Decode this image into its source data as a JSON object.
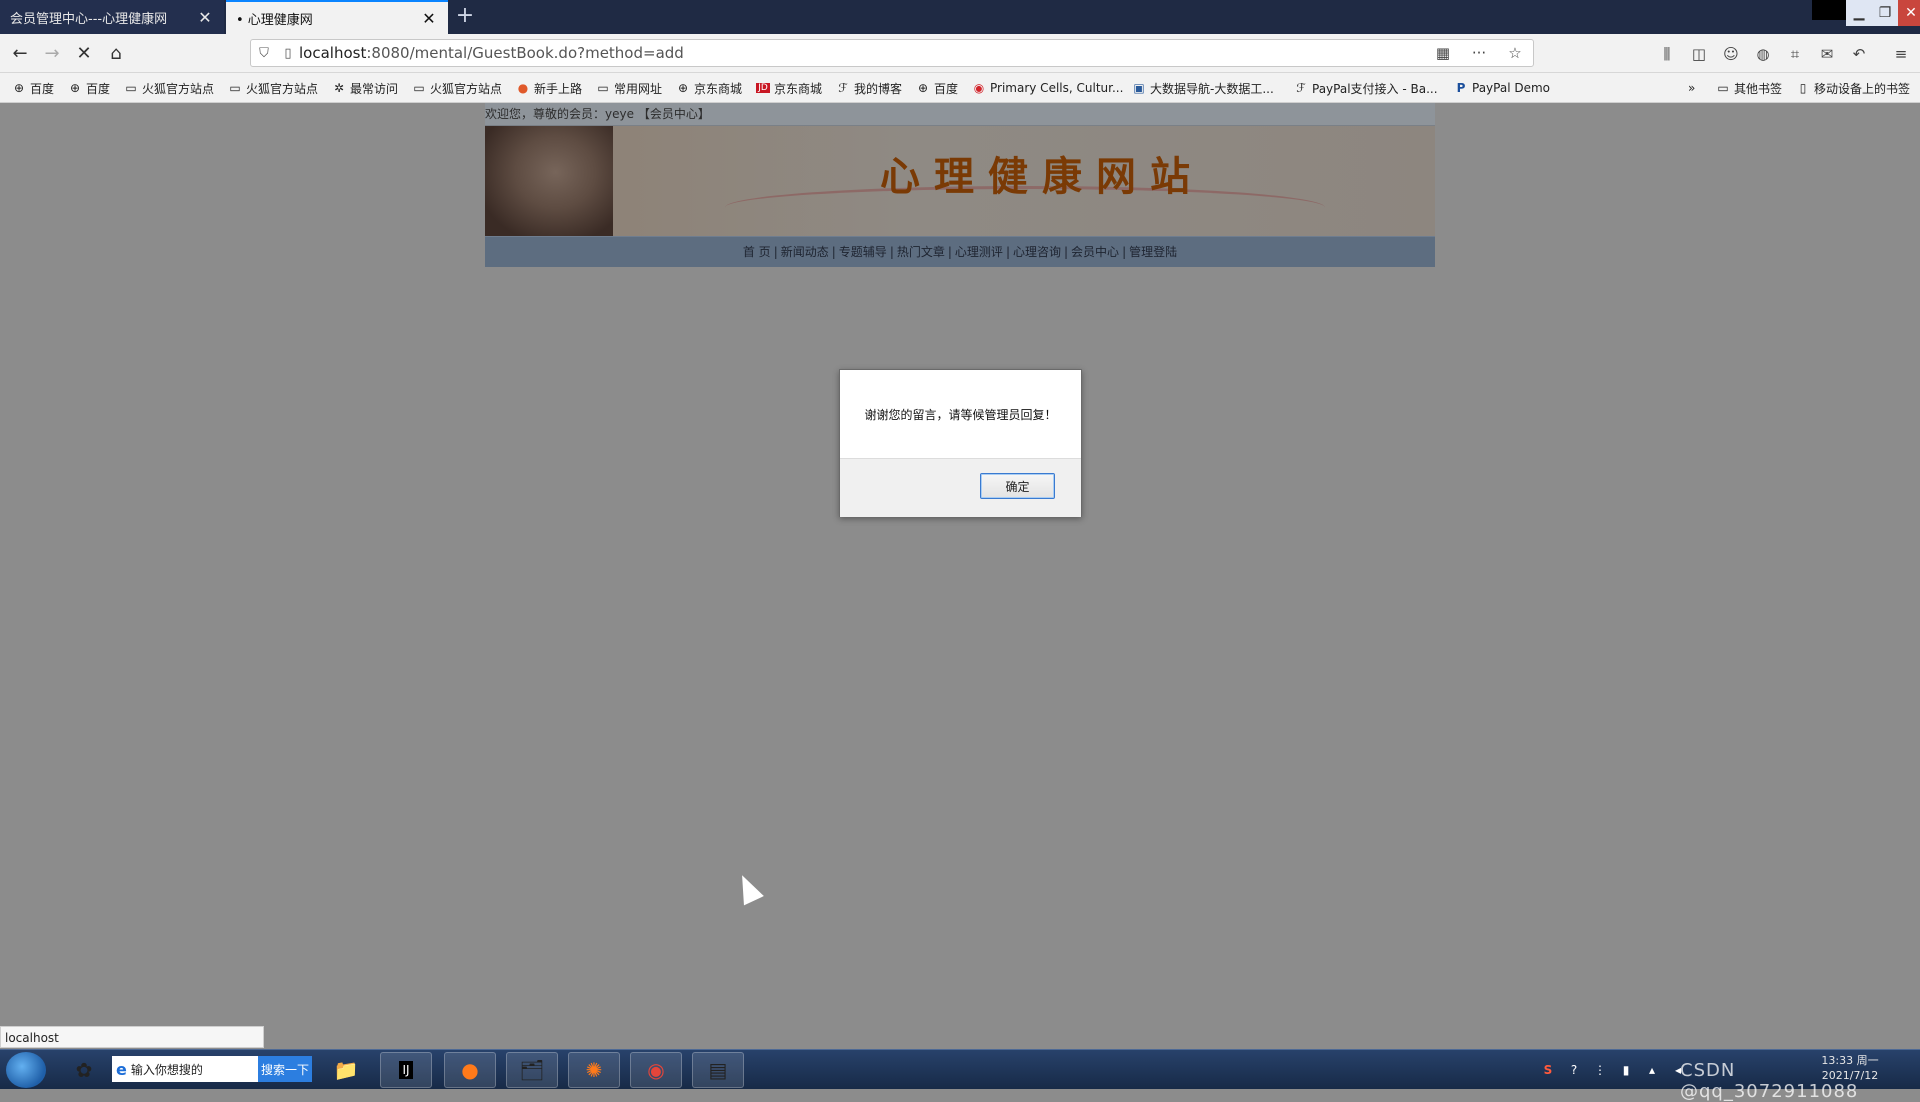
{
  "browser": {
    "tabs": [
      {
        "label": "会员管理中心---心理健康网",
        "active": false
      },
      {
        "label": "• 心理健康网",
        "active": true
      }
    ],
    "new_tab": "+",
    "url_host": "localhost",
    "url_path": ":8080/mental/GuestBook.do?method=add",
    "status_url": "localhost"
  },
  "bookmarks": [
    {
      "icon": "globe-icon",
      "label": "百度"
    },
    {
      "icon": "globe-icon",
      "label": "百度"
    },
    {
      "icon": "folder-icon",
      "label": "火狐官方站点"
    },
    {
      "icon": "folder-icon",
      "label": "火狐官方站点"
    },
    {
      "icon": "gear-icon",
      "label": "最常访问"
    },
    {
      "icon": "folder-icon",
      "label": "火狐官方站点"
    },
    {
      "icon": "firefox-icon",
      "label": "新手上路"
    },
    {
      "icon": "folder-icon",
      "label": "常用网址"
    },
    {
      "icon": "globe-icon",
      "label": "京东商城"
    },
    {
      "icon": "jd-icon",
      "label": "京东商城"
    },
    {
      "icon": "blog-icon",
      "label": "我的博客"
    },
    {
      "icon": "globe-icon",
      "label": "百度"
    },
    {
      "icon": "opera-icon",
      "label": "Primary Cells, Cultur..."
    },
    {
      "icon": "site-icon",
      "label": "大数据导航-大数据工..."
    },
    {
      "icon": "blog-icon",
      "label": "PayPal支付接入 - Ba..."
    },
    {
      "icon": "paypal-icon",
      "label": "PayPal Demo"
    }
  ],
  "bookmarks_right": [
    {
      "icon": "folder-icon",
      "label": "其他书签"
    },
    {
      "icon": "mobile-icon",
      "label": "移动设备上的书签"
    }
  ],
  "site": {
    "welcome_prefix": "欢迎您，尊敬的会员：yeye",
    "welcome_link": "【会员中心】",
    "banner_title": "心理健康网站",
    "nav": [
      "首 页",
      "新闻动态",
      "专题辅导",
      "热门文章",
      "心理测评",
      "心理咨询",
      "会员中心",
      "管理登陆"
    ]
  },
  "dialog": {
    "message": "谢谢您的留言，请等候管理员回复！",
    "ok_label": "确定"
  },
  "taskbar": {
    "search_placeholder": "输入你想搜的",
    "search_button": "搜索一下",
    "clock_time": "13:33 周一",
    "clock_date": "2021/7/12",
    "watermark": "CSDN @qq_3072911088"
  },
  "colors": {
    "tab_accent": "#0a84ff",
    "banner_title": "#7a3a05",
    "ok_border": "#3a7ad0"
  }
}
